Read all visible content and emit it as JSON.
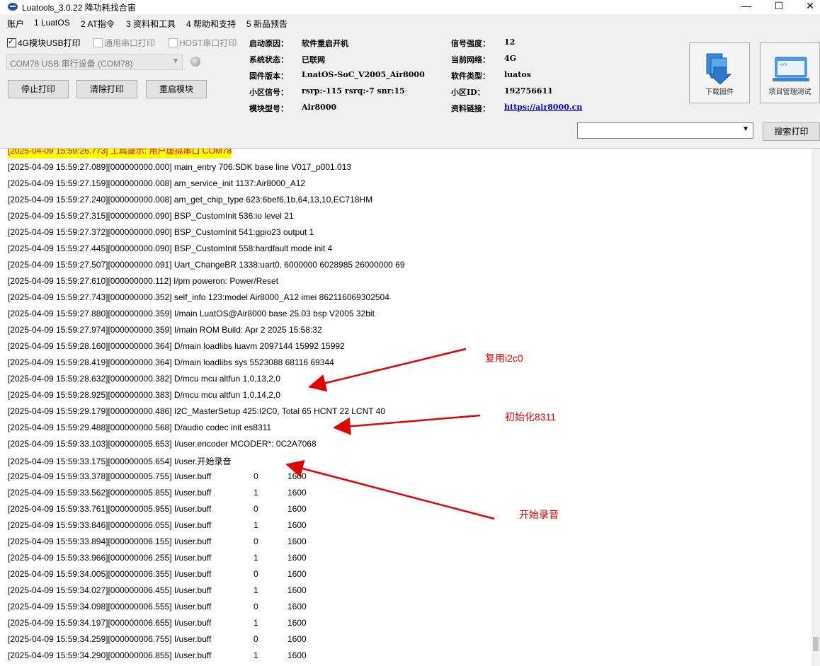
{
  "window": {
    "title": "Luatools_3.0.22 降功耗找合宙",
    "minimize": "—",
    "maximize": "☐",
    "close": "✕"
  },
  "menu": [
    "账户",
    "1 LuatOS",
    "2 AT指令",
    "3 资料和工具",
    "4 帮助和支持",
    "5 新品预告"
  ],
  "options": {
    "usb_print": "4G模块USB打印",
    "serial_print": "通用串口打印",
    "host_print": "HOST串口打印"
  },
  "port": {
    "selected": "COM78 USB 串行设备 (COM78)"
  },
  "buttons": {
    "stop_print": "停止打印",
    "clear_print": "清除打印",
    "restart_module": "重启模块",
    "download_firmware": "下载固件",
    "project_management": "项目管理测试",
    "search_print": "搜索打印"
  },
  "device_info": [
    {
      "label": "启动原因：",
      "value": "软件重启开机"
    },
    {
      "label": "系统状态：",
      "value": "已联网"
    },
    {
      "label": "固件版本：",
      "value": "LuatOS-SoC_V2005_Air8000"
    },
    {
      "label": "小区信号：",
      "value": "rsrp:-115 rsrq:-7 snr:15"
    },
    {
      "label": "模块型号：",
      "value": "Air8000"
    }
  ],
  "network_info": [
    {
      "label": "信号强度：",
      "value": "12"
    },
    {
      "label": "当前网络：",
      "value": "4G"
    },
    {
      "label": "软件类型：",
      "value": "luatos"
    },
    {
      "label": "小区ID：",
      "value": "192756611"
    },
    {
      "label": "资料链接：",
      "value": "https://air8000.cn"
    }
  ],
  "log": {
    "header": "[2025-04-09 15:59:26.773] 工具提示: 用户虚拟串口 COM78",
    "lines": [
      "[2025-04-09 15:59:27.089][000000000.000] main_entry 706:SDK base line V017_p001.013",
      "[2025-04-09 15:59:27.159][000000000.008] am_service_init 1137:Air8000_A12",
      "[2025-04-09 15:59:27.240][000000000.008] am_get_chip_type 623:6bef6,1b,64,13,10,EC718HM",
      "[2025-04-09 15:59:27.315][000000000.090] BSP_CustomInit 536:io level 21",
      "[2025-04-09 15:59:27.372][000000000.090] BSP_CustomInit 541:gpio23 output 1",
      "[2025-04-09 15:59:27.445][000000000.090] BSP_CustomInit 558:hardfault mode init 4",
      "[2025-04-09 15:59:27.507][000000000.091] Uart_ChangeBR 1338:uart0, 6000000 6028985 26000000 69",
      "[2025-04-09 15:59:27.610][000000000.112] I/pm poweron: Power/Reset",
      "[2025-04-09 15:59:27.743][000000000.352] self_info 123:model Air8000_A12 imei 862116069302504",
      "[2025-04-09 15:59:27.880][000000000.359] I/main LuatOS@Air8000 base 25.03 bsp V2005 32bit",
      "[2025-04-09 15:59:27.974][000000000.359] I/main ROM Build: Apr  2 2025 15:58:32",
      "[2025-04-09 15:59:28.160][000000000.364] D/main loadlibs luavm 2097144 15992 15992",
      "[2025-04-09 15:59:28.419][000000000.364] D/main loadlibs sys   5523088 68116 69344",
      "[2025-04-09 15:59:28.632][000000000.382] D/mcu mcu altfun 1,0,13,2,0",
      "[2025-04-09 15:59:28.925][000000000.383] D/mcu mcu altfun 1,0,14,2,0",
      "[2025-04-09 15:59:29.179][000000000.486] I2C_MasterSetup 425:I2C0, Total 65 HCNT 22 LCNT 40",
      "[2025-04-09 15:59:29.488][000000000.568] D/audio codec init es8311",
      "[2025-04-09 15:59:33.103][000000005.653] I/user.encoder MCODER*: 0C2A7068",
      "[2025-04-09 15:59:33.175][000000005.654] I/user.开始录音"
    ],
    "buff_lines": [
      {
        "prefix": "[2025-04-09 15:59:33.378][000000005.755] I/user.buff",
        "a": "0",
        "b": "1600"
      },
      {
        "prefix": "[2025-04-09 15:59:33.562][000000005.855] I/user.buff",
        "a": "1",
        "b": "1600"
      },
      {
        "prefix": "[2025-04-09 15:59:33.761][000000005.955] I/user.buff",
        "a": "0",
        "b": "1600"
      },
      {
        "prefix": "[2025-04-09 15:59:33.846][000000006.055] I/user.buff",
        "a": "1",
        "b": "1600"
      },
      {
        "prefix": "[2025-04-09 15:59:33.894][000000006.155] I/user.buff",
        "a": "0",
        "b": "1600"
      },
      {
        "prefix": "[2025-04-09 15:59:33.966][000000006.255] I/user.buff",
        "a": "1",
        "b": "1600"
      },
      {
        "prefix": "[2025-04-09 15:59:34.005][000000006.355] I/user.buff",
        "a": "0",
        "b": "1600"
      },
      {
        "prefix": "[2025-04-09 15:59:34.027][000000006.455] I/user.buff",
        "a": "1",
        "b": "1600"
      },
      {
        "prefix": "[2025-04-09 15:59:34.098][000000006.555] I/user.buff",
        "a": "0",
        "b": "1600"
      },
      {
        "prefix": "[2025-04-09 15:59:34.197][000000006.655] I/user.buff",
        "a": "1",
        "b": "1600"
      },
      {
        "prefix": "[2025-04-09 15:59:34.259][000000006.755] I/user.buff",
        "a": "0",
        "b": "1600"
      },
      {
        "prefix": "[2025-04-09 15:59:34.290][000000006.855] I/user.buff",
        "a": "1",
        "b": "1600"
      }
    ]
  },
  "annotations": {
    "i2c": "复用i2c0",
    "codec": "初始化8311",
    "record": "开始录音"
  },
  "colors": {
    "annotation": "#e00000",
    "highlight": "#ffff00",
    "link": "#0000cc"
  }
}
